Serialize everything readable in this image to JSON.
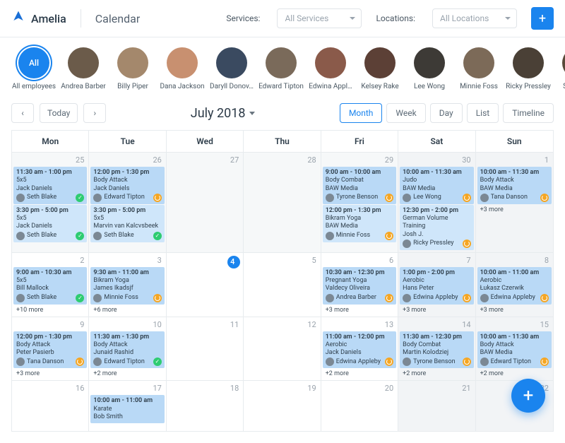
{
  "brand": "Amelia",
  "page_title": "Calendar",
  "filters": {
    "services_label": "Services:",
    "services_placeholder": "All Services",
    "locations_label": "Locations:",
    "locations_placeholder": "All Locations"
  },
  "employees": [
    {
      "name": "All employees",
      "all": true,
      "label": "All"
    },
    {
      "name": "Andrea Barber",
      "color": "#6b5b4a"
    },
    {
      "name": "Billy Piper",
      "color": "#a4886c"
    },
    {
      "name": "Dana Jackson",
      "color": "#c89070"
    },
    {
      "name": "Daryll Donov…",
      "color": "#3a4a60"
    },
    {
      "name": "Edward Tipton",
      "color": "#7a6a5a"
    },
    {
      "name": "Edwina Appl…",
      "color": "#8a5a4a"
    },
    {
      "name": "Kelsey Rake",
      "color": "#5c4036"
    },
    {
      "name": "Lee Wong",
      "color": "#3d3a36"
    },
    {
      "name": "Minnie Foss",
      "color": "#7c6a58"
    },
    {
      "name": "Ricky Pressley",
      "color": "#4a4036"
    },
    {
      "name": "Seth Blak",
      "color": "#5a4a3a"
    }
  ],
  "nav": {
    "prev": "‹",
    "today": "Today",
    "next": "›"
  },
  "month_title": "July 2018",
  "views": {
    "month": "Month",
    "week": "Week",
    "day": "Day",
    "list": "List",
    "timeline": "Timeline"
  },
  "dow": [
    "Mon",
    "Tue",
    "Wed",
    "Thu",
    "Fri",
    "Sat",
    "Sun"
  ],
  "weeks": [
    {
      "days": [
        {
          "num": 25,
          "other": true,
          "events": [
            {
              "time": "11:30 am - 1:00 pm",
              "title": "5x5",
              "sub": "Jack Daniels",
              "assignee": "Seth Blake",
              "status": "ok"
            },
            {
              "time": "3:30 pm - 5:00 pm",
              "title": "5x5",
              "sub": "Jack Daniels",
              "assignee": "Seth Blake",
              "status": "ok",
              "alt": true
            }
          ]
        },
        {
          "num": 26,
          "other": true,
          "events": [
            {
              "time": "12:00 pm - 1:30 pm",
              "title": "Body Attack",
              "sub": "Jack Daniels",
              "assignee": "Edward Tipton",
              "status": "pend"
            },
            {
              "time": "3:30 pm - 5:00 pm",
              "title": "5x5",
              "sub": "Marvin van Kalcvsbeek",
              "assignee": "Seth Blake",
              "status": "ok",
              "alt": true
            }
          ]
        },
        {
          "num": 27,
          "other": true,
          "events": []
        },
        {
          "num": 28,
          "other": true,
          "events": []
        },
        {
          "num": 29,
          "other": true,
          "events": [
            {
              "time": "9:00 am - 10:00 am",
              "title": "Body Combat",
              "sub": "BAW Media",
              "assignee": "Tyrone Benson",
              "status": "pend"
            },
            {
              "time": "12:00 pm - 1:30 pm",
              "title": "Bikram Yoga",
              "sub": "BAW Media",
              "assignee": "Minnie Foss",
              "status": "pend",
              "alt": true
            }
          ]
        },
        {
          "num": 30,
          "other": true,
          "weekend": true,
          "events": [
            {
              "time": "10:00 am - 11:30 am",
              "title": "Judo",
              "sub": "BAW Media",
              "assignee": "Lee Wong",
              "status": "pend"
            },
            {
              "time": "12:30 pm - 2:00 pm",
              "title": "German Volume Training",
              "sub": "Josh J.",
              "assignee": "Ricky Pressley",
              "status": "pend",
              "alt": true
            }
          ]
        },
        {
          "num": 1,
          "weekend": true,
          "events": [
            {
              "time": "10:00 am - 11:30 am",
              "title": "Body Attack",
              "sub": "BAW Media",
              "assignee": "Tana Danson",
              "status": "pend"
            }
          ],
          "more": "+3 more"
        }
      ]
    },
    {
      "days": [
        {
          "num": 2,
          "events": [
            {
              "time": "9:00 am - 10:30 am",
              "title": "5x5",
              "sub": "Bill Mallock",
              "assignee": "Seth Blake",
              "status": "ok"
            }
          ],
          "more": "+10 more"
        },
        {
          "num": 3,
          "events": [
            {
              "time": "9:30 am - 11:00 am",
              "title": "Bikram Yoga",
              "sub": "James Ikadsjf",
              "assignee": "Minnie Foss",
              "status": "pend"
            }
          ],
          "more": "+6 more"
        },
        {
          "num": 4,
          "today": true,
          "events": []
        },
        {
          "num": 5,
          "events": []
        },
        {
          "num": 6,
          "events": [
            {
              "time": "10:30 am - 12:30 pm",
              "title": "Pregnant Yoga",
              "sub": "Valdecy Oliveira",
              "assignee": "Andrea Barber",
              "status": "pend"
            }
          ],
          "more": "+3 more"
        },
        {
          "num": 7,
          "weekend": true,
          "events": [
            {
              "time": "1:00 pm - 2:00 pm",
              "title": "Aerobic",
              "sub": "Hans Peter",
              "assignee": "Edwina Appleby",
              "status": "pend"
            }
          ],
          "more": "+3 more"
        },
        {
          "num": 8,
          "weekend": true,
          "events": [
            {
              "time": "10:00 am - 11:00 am",
              "title": "Aerobic",
              "sub": "Łukasz Czerwik",
              "assignee": "Edwina Appleby",
              "status": "pend"
            }
          ],
          "more": "+3 more"
        }
      ]
    },
    {
      "days": [
        {
          "num": 9,
          "events": [
            {
              "time": "12:00 pm - 1:30 pm",
              "title": "Body Attack",
              "sub": "Peter Pasierb",
              "assignee": "Tana Danson",
              "status": "pend"
            }
          ],
          "more": "+3 more"
        },
        {
          "num": 10,
          "events": [
            {
              "time": "11:30 am - 1:30 pm",
              "title": "Body Attack",
              "sub": "Junaid Rashid",
              "assignee": "Edward Tipton",
              "status": "ok"
            }
          ],
          "more": "+2 more"
        },
        {
          "num": 11,
          "events": []
        },
        {
          "num": 12,
          "events": []
        },
        {
          "num": 13,
          "events": [
            {
              "time": "11:00 am - 12:00 pm",
              "title": "Aerobic",
              "sub": "Jack Daniels",
              "assignee": "Edwina Appleby",
              "status": "pend"
            }
          ],
          "more": "+2 more"
        },
        {
          "num": 14,
          "weekend": true,
          "events": [
            {
              "time": "11:30 am - 12:30 pm",
              "title": "Body Combat",
              "sub": "Martin Kolodziej",
              "assignee": "Tyrone Benson",
              "status": "pend"
            }
          ],
          "more": "+2 more"
        },
        {
          "num": 15,
          "weekend": true,
          "events": [
            {
              "time": "10:00 am - 11:30 am",
              "title": "Body Attack",
              "sub": "BAW Media",
              "assignee": "Edward Tipton",
              "status": "pend"
            }
          ],
          "more": "+2 more"
        }
      ]
    },
    {
      "days": [
        {
          "num": 16,
          "events": []
        },
        {
          "num": 17,
          "events": [
            {
              "time": "10:00 am - 11:00 am",
              "title": "Karate",
              "sub": "Bob Smith"
            }
          ]
        },
        {
          "num": 18,
          "events": []
        },
        {
          "num": 19,
          "events": []
        },
        {
          "num": 20,
          "events": []
        },
        {
          "num": 21,
          "weekend": true,
          "events": []
        },
        {
          "num": 22,
          "weekend": true,
          "events": []
        }
      ]
    }
  ]
}
